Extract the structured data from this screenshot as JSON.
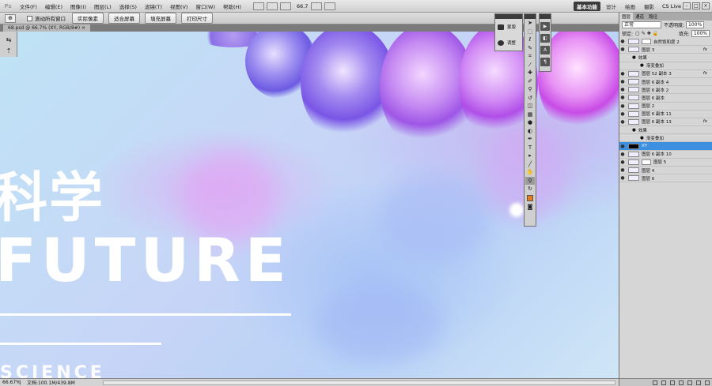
{
  "menubar": {
    "logo": "Ps",
    "items": [
      "文件(F)",
      "编辑(E)",
      "图像(I)",
      "图层(L)",
      "选择(S)",
      "滤镜(T)",
      "视图(V)",
      "窗口(W)",
      "帮助(H)"
    ],
    "zoom": "66.7",
    "workspaces": [
      "基本功能",
      "设计",
      "绘画",
      "摄影"
    ],
    "cs_live": "CS Live"
  },
  "options": {
    "scroll_all_label": "滚动所有窗口",
    "buttons": [
      "实际像素",
      "适合屏幕",
      "填充屏幕",
      "打印尺寸"
    ]
  },
  "document": {
    "tab_title": "68.psd @ 66.7% (XY, RGB/8#)"
  },
  "canvas": {
    "headline_cn": "科学",
    "headline_en": "FUTURE",
    "sub_en": "SCIENCE"
  },
  "status": {
    "zoom": "66.67%",
    "doc_size": "文档:100.1M/439.8M"
  },
  "adjust_panel": {
    "items": [
      "蒙版",
      "调整"
    ]
  },
  "layers_panel": {
    "tabs": [
      "图层",
      "通道",
      "路径"
    ],
    "blend_mode": "正常",
    "opacity_label": "不透明度:",
    "opacity_value": "100%",
    "lock_label": "锁定:",
    "fill_label": "填充:",
    "fill_value": "100%",
    "layers": [
      {
        "name": "自然饱和度 2",
        "type": "adjust"
      },
      {
        "name": "图层 3",
        "type": "fx"
      },
      {
        "name": "效果",
        "type": "sub"
      },
      {
        "name": "渐变叠加",
        "type": "sub2"
      },
      {
        "name": "图层 52 副本 3",
        "type": "fx"
      },
      {
        "name": "图层 6 副本 4",
        "type": "layer"
      },
      {
        "name": "图层 6 副本 2",
        "type": "layer"
      },
      {
        "name": "图层 6 副本",
        "type": "layer"
      },
      {
        "name": "图层 2",
        "type": "layer"
      },
      {
        "name": "图层 6 副本 11",
        "type": "layer"
      },
      {
        "name": "图层 6 副本 13",
        "type": "fx"
      },
      {
        "name": "效果",
        "type": "sub"
      },
      {
        "name": "渐变叠加",
        "type": "sub2"
      },
      {
        "name": "XY",
        "type": "selected"
      },
      {
        "name": "图层 6 副本 10",
        "type": "layer"
      },
      {
        "name": "图层 5",
        "type": "mask"
      },
      {
        "name": "图层 4",
        "type": "layer"
      },
      {
        "name": "图层 6",
        "type": "layer"
      }
    ]
  },
  "colors": {
    "foreground": "#e87b1a",
    "selection": "#3d8fe0"
  }
}
